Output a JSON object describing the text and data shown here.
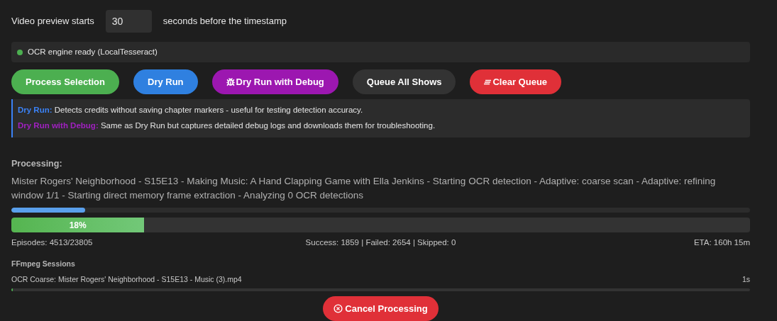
{
  "preview": {
    "label": "Video preview starts",
    "value": "30",
    "suffix": "seconds before the timestamp"
  },
  "engine_status": {
    "text": "OCR engine ready (LocalTesseract)",
    "color": "#4caf50"
  },
  "buttons": [
    {
      "label": "Process Selection",
      "color": "#4caf50",
      "kind": "plain"
    },
    {
      "label": "Dry Run",
      "color": "#2f80e0",
      "kind": "plain"
    },
    {
      "label": "Dry Run with Debug",
      "color": "#9c17b0",
      "kind": "debug"
    },
    {
      "label": "Queue All Shows",
      "color": "#333333",
      "kind": "plain"
    },
    {
      "label": "Clear Queue",
      "color": "#e03038",
      "kind": "clear"
    }
  ],
  "info": [
    {
      "label": "Dry Run:",
      "text": "Detects credits without saving chapter markers - useful for testing detection accuracy.",
      "color": "#3b82f6"
    },
    {
      "label": "Dry Run with Debug:",
      "text": "Same as Dry Run but captures detailed debug logs and downloads them for troubleshooting.",
      "color": "#a020c0"
    }
  ],
  "processing": {
    "heading": "Processing:",
    "description": "Mister Rogers' Neighborhood - S15E13 - Making Music: A Hand Clapping Game with Ella Jenkins - Starting OCR detection - Adaptive: coarse scan - Adaptive: refining window 1/1 - Starting direct memory frame extraction - Analyzing 0 OCR detections",
    "step_progress": {
      "level": 0.1
    },
    "overall_progress": {
      "level": 0.18,
      "label": "18%"
    },
    "episodes": "Episodes: 4513/23805",
    "results": "Success: 1859 | Failed: 2654 | Skipped: 0",
    "eta": "ETA: 160h 15m"
  },
  "ffmpeg": {
    "heading": "FFmpeg Sessions",
    "sessions": [
      {
        "name": "OCR Coarse: Mister Rogers' Neighborhood - S15E13 - Music (3).mp4",
        "time": "1s",
        "level": 0.002
      }
    ]
  },
  "cancel_button": {
    "label": "Cancel Processing"
  }
}
